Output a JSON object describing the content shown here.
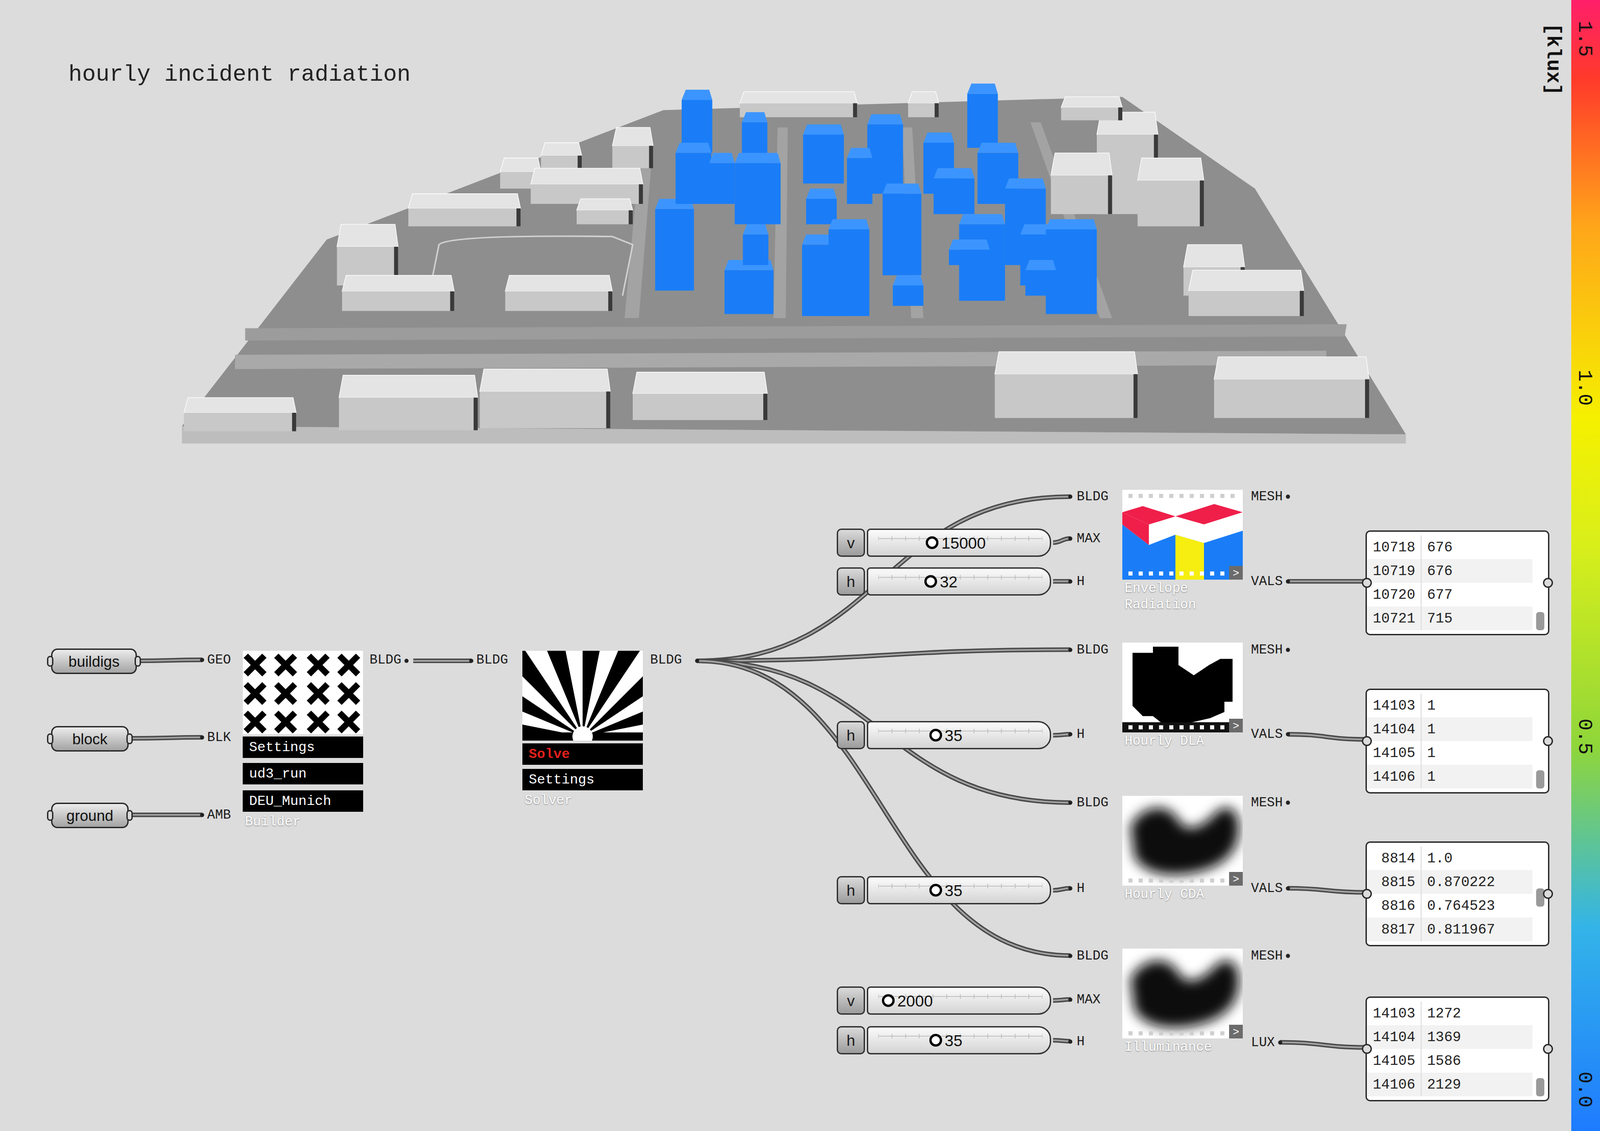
{
  "title": "hourly incident radiation",
  "legend": {
    "unit": "[klux]",
    "ticks": [
      "1.5",
      "1.0",
      "0.5",
      "0.0"
    ]
  },
  "params": [
    {
      "label": "buildigs"
    },
    {
      "label": "block"
    },
    {
      "label": "ground"
    }
  ],
  "builder": {
    "name": "Builder",
    "inputs": [
      "GEO",
      "BLK",
      "AMB"
    ],
    "output": "BLDG",
    "menu": [
      "Settings",
      "ud3_run",
      "DEU_Munich"
    ]
  },
  "solver": {
    "name": "Solver",
    "input": "BLDG",
    "output": "BLDG",
    "menu": [
      {
        "label": "Solve",
        "highlight": true
      },
      {
        "label": "Settings",
        "highlight": false
      }
    ]
  },
  "components": [
    {
      "name": "Envelope Radiation",
      "kind": "envelope",
      "more": ">",
      "inputs": [
        "BLDG",
        "MAX",
        "H"
      ],
      "outputs": [
        "MESH",
        "VALS"
      ],
      "sliders": [
        {
          "key": "v",
          "value": "15000",
          "level": 0.33
        },
        {
          "key": "h",
          "value": "32",
          "level": 0.32
        }
      ],
      "panel": {
        "rows": [
          [
            "10718",
            "676"
          ],
          [
            "10719",
            "676"
          ],
          [
            "10720",
            "677"
          ],
          [
            "10721",
            "715"
          ]
        ],
        "scroll": 1
      }
    },
    {
      "name": "Hourly DLA",
      "kind": "dla",
      "more": ">",
      "inputs": [
        "BLDG",
        "H"
      ],
      "outputs": [
        "MESH",
        "VALS"
      ],
      "sliders": [
        {
          "key": "h",
          "value": "35",
          "level": 0.35
        }
      ],
      "panel": {
        "rows": [
          [
            "14103",
            "1"
          ],
          [
            "14104",
            "1"
          ],
          [
            "14105",
            "1"
          ],
          [
            "14106",
            "1"
          ]
        ],
        "scroll": 1
      }
    },
    {
      "name": "Hourly CDA",
      "kind": "blur",
      "more": ">",
      "inputs": [
        "BLDG",
        "H"
      ],
      "outputs": [
        "MESH",
        "VALS"
      ],
      "sliders": [
        {
          "key": "h",
          "value": "35",
          "level": 0.35
        }
      ],
      "panel": {
        "rows": [
          [
            "8814",
            "1.0"
          ],
          [
            "8815",
            "0.870222"
          ],
          [
            "8816",
            "0.764523"
          ],
          [
            "8817",
            "0.811967"
          ]
        ],
        "scroll": 0.55
      }
    },
    {
      "name": "Illuminance",
      "kind": "blur",
      "more": ">",
      "inputs": [
        "BLDG",
        "MAX",
        "H"
      ],
      "outputs": [
        "MESH",
        "LUX"
      ],
      "sliders": [
        {
          "key": "v",
          "value": "2000",
          "level": 0.06
        },
        {
          "key": "h",
          "value": "35",
          "level": 0.35
        }
      ],
      "panel": {
        "rows": [
          [
            "14103",
            "1272"
          ],
          [
            "14104",
            "1369"
          ],
          [
            "14105",
            "1586"
          ],
          [
            "14106",
            "2129"
          ]
        ],
        "scroll": 1
      }
    }
  ]
}
